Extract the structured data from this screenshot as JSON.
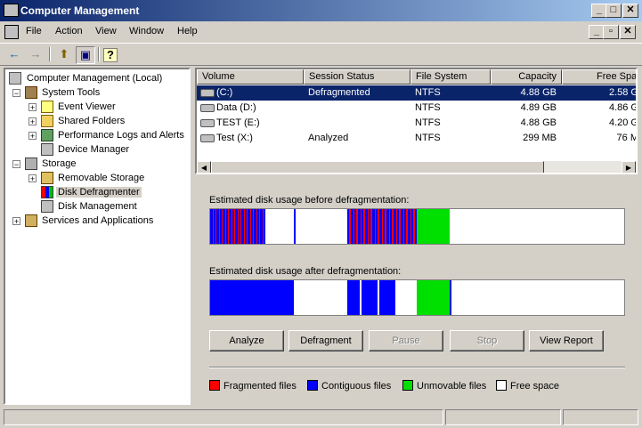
{
  "window": {
    "title": "Computer Management",
    "min": "_",
    "max": "□",
    "close": "✕"
  },
  "menu": [
    {
      "label": "File"
    },
    {
      "label": "Action"
    },
    {
      "label": "View"
    },
    {
      "label": "Window"
    },
    {
      "label": "Help"
    }
  ],
  "inner_controls": {
    "min": "_",
    "restore": "▫",
    "close": "✕"
  },
  "toolbar": {
    "back": "←",
    "forward": "→",
    "up": "⬆",
    "show_hide": "▣",
    "help": "?"
  },
  "tree": {
    "root": "Computer Management (Local)",
    "system_tools": "System Tools",
    "event_viewer": "Event Viewer",
    "shared_folders": "Shared Folders",
    "perf_logs": "Performance Logs and Alerts",
    "device_manager": "Device Manager",
    "storage": "Storage",
    "removable_storage": "Removable Storage",
    "disk_defragmenter": "Disk Defragmenter",
    "disk_management": "Disk Management",
    "services_apps": "Services and Applications"
  },
  "volumes": {
    "columns": [
      "Volume",
      "Session Status",
      "File System",
      "Capacity",
      "Free Spa"
    ],
    "rows": [
      {
        "volume": "(C:)",
        "status": "Defragmented",
        "fs": "NTFS",
        "capacity": "4.88 GB",
        "free": "2.58 G"
      },
      {
        "volume": "Data (D:)",
        "status": "",
        "fs": "NTFS",
        "capacity": "4.89 GB",
        "free": "4.86 G"
      },
      {
        "volume": "TEST (E:)",
        "status": "",
        "fs": "NTFS",
        "capacity": "4.88 GB",
        "free": "4.20 G"
      },
      {
        "volume": "Test (X:)",
        "status": "Analyzed",
        "fs": "NTFS",
        "capacity": "299 MB",
        "free": "76 M"
      }
    ]
  },
  "defrag": {
    "before_label": "Estimated disk usage before defragmentation:",
    "after_label": "Estimated disk usage after defragmentation:",
    "buttons": {
      "analyze": "Analyze",
      "defragment": "Defragment",
      "pause": "Pause",
      "stop": "Stop",
      "report": "View Report"
    },
    "legend": {
      "fragmented": "Fragmented files",
      "contiguous": "Contiguous files",
      "unmovable": "Unmovable files",
      "free": "Free space"
    },
    "colors": {
      "fragmented": "#ff0000",
      "contiguous": "#0000ff",
      "unmovable": "#00e000",
      "free": "#ffffff"
    }
  }
}
